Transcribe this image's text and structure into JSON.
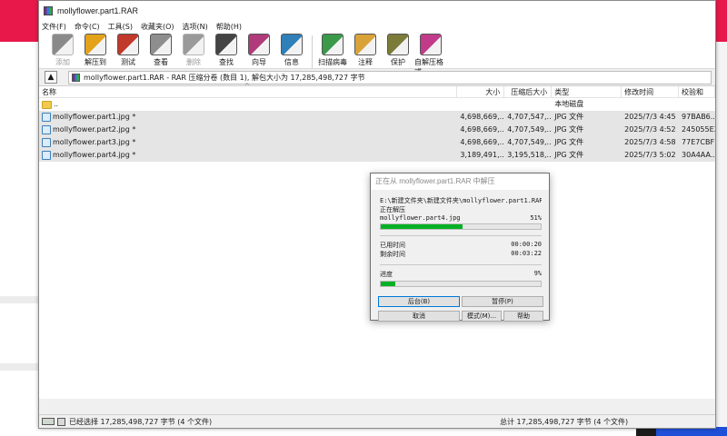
{
  "window": {
    "title": "mollyflower.part1.RAR"
  },
  "menu": [
    "文件(F)",
    "命令(C)",
    "工具(S)",
    "收藏夹(O)",
    "选项(N)",
    "帮助(H)"
  ],
  "toolbar": [
    {
      "label": "添加",
      "icon": "add-icon",
      "color": "#8a8a8a",
      "disabled": true
    },
    {
      "label": "解压到",
      "icon": "extract-to-icon",
      "color": "#e3a21a",
      "disabled": false
    },
    {
      "label": "测试",
      "icon": "test-icon",
      "color": "#c0392b",
      "disabled": false
    },
    {
      "label": "查看",
      "icon": "view-icon",
      "color": "#8e8e8e",
      "disabled": false
    },
    {
      "label": "删除",
      "icon": "delete-icon",
      "color": "#9a9a9a",
      "disabled": true
    },
    {
      "label": "查找",
      "icon": "find-icon",
      "color": "#444444",
      "disabled": false
    },
    {
      "label": "向导",
      "icon": "wizard-icon",
      "color": "#b03a7a",
      "disabled": false
    },
    {
      "label": "信息",
      "icon": "info-icon",
      "color": "#2f7fb8",
      "disabled": false
    },
    {
      "label": "扫描病毒",
      "icon": "scan-virus-icon",
      "color": "#3a9a4a",
      "disabled": false
    },
    {
      "label": "注释",
      "icon": "comment-icon",
      "color": "#d9a33a",
      "disabled": false
    },
    {
      "label": "保护",
      "icon": "protect-icon",
      "color": "#7c7c3a",
      "disabled": false
    },
    {
      "label": "自解压格式",
      "icon": "sfx-icon",
      "color": "#c23b8a",
      "disabled": false
    }
  ],
  "address": {
    "text": "mollyflower.part1.RAR - RAR 压缩分卷 (数目 1), 解包大小为 17,285,498,727 字节"
  },
  "columns": {
    "name": "名称",
    "size": "大小",
    "packed": "压缩后大小",
    "type": "类型",
    "modified": "修改时间",
    "crc": "校验和"
  },
  "files": [
    {
      "name": "..",
      "size": "",
      "packed": "",
      "type": "本地磁盘",
      "modified": "",
      "crc": "",
      "folder": true
    },
    {
      "name": "mollyflower.part1.jpg *",
      "size": "4,698,669,...",
      "packed": "4,707,547,...",
      "type": "JPG 文件",
      "modified": "2025/7/3 4:45",
      "crc": "97BAB6...",
      "folder": false
    },
    {
      "name": "mollyflower.part2.jpg *",
      "size": "4,698,669,...",
      "packed": "4,707,549,...",
      "type": "JPG 文件",
      "modified": "2025/7/3 4:52",
      "crc": "245055E3",
      "folder": false
    },
    {
      "name": "mollyflower.part3.jpg *",
      "size": "4,698,669,...",
      "packed": "4,707,549,...",
      "type": "JPG 文件",
      "modified": "2025/7/3 4:58",
      "crc": "77E7CBF1",
      "folder": false
    },
    {
      "name": "mollyflower.part4.jpg *",
      "size": "3,189,491,...",
      "packed": "3,195,518,...",
      "type": "JPG 文件",
      "modified": "2025/7/3 5:02",
      "crc": "30A4AA...",
      "folder": false
    }
  ],
  "status": {
    "left": "已经选择 17,285,498,727 字节 (4 个文件)",
    "right": "总计 17,285,498,727 字节 (4 个文件)"
  },
  "dialog": {
    "title": "正在从 mollyflower.part1.RAR 中解压",
    "dest_path": "E:\\新建文件夹\\新建文件夹\\mollyflower.part1.RAR",
    "action": "正在解压",
    "current_file": "mollyflower.part4.jpg",
    "file_percent_label": "51%",
    "file_progress": 0.51,
    "elapsed_label": "已用时间",
    "elapsed": "00:00:20",
    "remaining_label": "剩余时间",
    "remaining": "00:03:22",
    "progress_label": "进度",
    "total_percent_label": "9%",
    "total_progress": 0.09,
    "buttons": {
      "background": "后台(B)",
      "pause": "暂停(P)",
      "cancel": "取消",
      "mode": "模式(M)...",
      "help": "帮助"
    }
  }
}
